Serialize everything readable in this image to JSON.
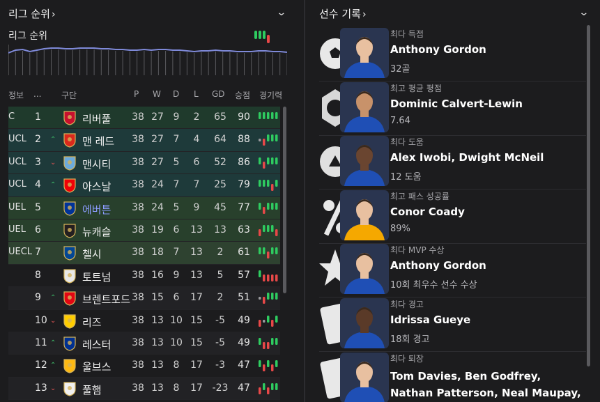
{
  "league_panel": {
    "header": "리그 순위",
    "subtitle": "리그 순위",
    "columns": {
      "info": "정보",
      "dots": "...",
      "club": "구단",
      "p": "P",
      "w": "W",
      "d": "D",
      "l": "L",
      "gd": "GD",
      "pts": "승점",
      "form": "경기력"
    },
    "rows": [
      {
        "q": "C",
        "pos": "1",
        "mv": "",
        "team": "리버풀",
        "p": "38",
        "w": "27",
        "d": "9",
        "l": "2",
        "gd": "65",
        "pts": "90",
        "crest": "#c8102e",
        "form": [
          "W",
          "W",
          "W",
          "W",
          "W"
        ],
        "bg": "#1f3a2c"
      },
      {
        "q": "UCL",
        "pos": "2",
        "mv": "up",
        "team": "맨 레드",
        "p": "38",
        "w": "27",
        "d": "7",
        "l": "4",
        "gd": "64",
        "pts": "88",
        "crest": "#da291c",
        "form": [
          "D",
          "L",
          "W",
          "W",
          "W"
        ],
        "bg": "#1e3a3a"
      },
      {
        "q": "UCL",
        "pos": "3",
        "mv": "down",
        "team": "맨시티",
        "p": "38",
        "w": "27",
        "d": "5",
        "l": "6",
        "gd": "52",
        "pts": "86",
        "crest": "#6cabdd",
        "form": [
          "W",
          "L",
          "W",
          "W",
          "W"
        ],
        "bg": "#1e3a3a"
      },
      {
        "q": "UCL",
        "pos": "4",
        "mv": "up",
        "team": "아스날",
        "p": "38",
        "w": "24",
        "d": "7",
        "l": "7",
        "gd": "25",
        "pts": "79",
        "crest": "#ef0107",
        "form": [
          "W",
          "W",
          "W",
          "L",
          "W"
        ],
        "bg": "#1e3a3a"
      },
      {
        "q": "UEL",
        "pos": "5",
        "mv": "",
        "team": "에버튼",
        "p": "38",
        "w": "24",
        "d": "5",
        "l": "9",
        "gd": "45",
        "pts": "77",
        "crest": "#003399",
        "form": [
          "W",
          "L",
          "W",
          "W",
          "W"
        ],
        "bg": "#28402c",
        "highlight": true
      },
      {
        "q": "UEL",
        "pos": "6",
        "mv": "",
        "team": "뉴캐슬",
        "p": "38",
        "w": "19",
        "d": "6",
        "l": "13",
        "gd": "13",
        "pts": "63",
        "crest": "#241f20",
        "form": [
          "L",
          "W",
          "W",
          "W",
          "L"
        ],
        "bg": "#28402c"
      },
      {
        "q": "UECL",
        "pos": "7",
        "mv": "",
        "team": "첼시",
        "p": "38",
        "w": "18",
        "d": "7",
        "l": "13",
        "gd": "2",
        "pts": "61",
        "crest": "#034694",
        "form": [
          "W",
          "W",
          "L",
          "W",
          "W"
        ],
        "bg": "#2e4230"
      },
      {
        "q": "",
        "pos": "8",
        "mv": "",
        "team": "토트넘",
        "p": "38",
        "w": "16",
        "d": "9",
        "l": "13",
        "gd": "5",
        "pts": "57",
        "crest": "#e8e8e8",
        "form": [
          "W",
          "L",
          "L",
          "L",
          "L"
        ],
        "bg": "#1c1c1e"
      },
      {
        "q": "",
        "pos": "9",
        "mv": "up",
        "team": "브렌트포드",
        "p": "38",
        "w": "15",
        "d": "6",
        "l": "17",
        "gd": "2",
        "pts": "51",
        "crest": "#e30613",
        "form": [
          "D",
          "L",
          "W",
          "W",
          "W"
        ],
        "bg": "#222225"
      },
      {
        "q": "",
        "pos": "10",
        "mv": "down",
        "team": "리즈",
        "p": "38",
        "w": "13",
        "d": "10",
        "l": "15",
        "gd": "-5",
        "pts": "49",
        "crest": "#ffcd00",
        "form": [
          "L",
          "D",
          "W",
          "L",
          "W"
        ],
        "bg": "#1c1c1e"
      },
      {
        "q": "",
        "pos": "11",
        "mv": "up",
        "team": "레스터",
        "p": "38",
        "w": "13",
        "d": "10",
        "l": "15",
        "gd": "-5",
        "pts": "49",
        "crest": "#003090",
        "form": [
          "W",
          "L",
          "L",
          "W",
          "W"
        ],
        "bg": "#222225"
      },
      {
        "q": "",
        "pos": "12",
        "mv": "up",
        "team": "울브스",
        "p": "38",
        "w": "13",
        "d": "8",
        "l": "17",
        "gd": "-3",
        "pts": "47",
        "crest": "#fdb913",
        "form": [
          "W",
          "L",
          "W",
          "L",
          "W"
        ],
        "bg": "#1c1c1e"
      },
      {
        "q": "",
        "pos": "13",
        "mv": "down",
        "team": "풀햄",
        "p": "38",
        "w": "13",
        "d": "8",
        "l": "17",
        "gd": "-23",
        "pts": "47",
        "crest": "#f0f0f0",
        "form": [
          "L",
          "W",
          "L",
          "W",
          "W"
        ],
        "bg": "#222225"
      }
    ],
    "mini_form": [
      "W",
      "W",
      "W",
      "L"
    ]
  },
  "records_panel": {
    "header": "선수 기록",
    "records": [
      {
        "label": "최다 득점",
        "name": "Anthony Gordon",
        "value": "32골",
        "icon": "ball-icon",
        "kit": "#1f4fb5",
        "skin": "#e8c0a0"
      },
      {
        "label": "최고 평균 평점",
        "name": "Dominic Calvert-Lewin",
        "value": "7.64",
        "icon": "badge-icon",
        "kit": "#1f4fb5",
        "skin": "#c8926a"
      },
      {
        "label": "최다 도움",
        "name": "Alex Iwobi, Dwight McNeil",
        "value": "12 도움",
        "icon": "assist-icon",
        "kit": "#1f4fb5",
        "skin": "#6a4530"
      },
      {
        "label": "최고 패스 성공률",
        "name": "Conor Coady",
        "value": "89%",
        "icon": "percent-icon",
        "kit": "#f5a800",
        "skin": "#e8c0a0"
      },
      {
        "label": "최다 MVP 수상",
        "name": "Anthony Gordon",
        "value": "10회 최우수 선수 수상",
        "icon": "star-icon",
        "kit": "#1f4fb5",
        "skin": "#e8c0a0"
      },
      {
        "label": "최다 경고",
        "name": "Idrissa Gueye",
        "value": "18회 경고",
        "icon": "card-icon",
        "kit": "#1f4fb5",
        "skin": "#5a3a28"
      },
      {
        "label": "최다 퇴장",
        "name": "Tom Davies, Ben Godfrey, Nathan Patterson, Neal Maupay,",
        "value": "",
        "icon": "red-card-icon",
        "kit": "#1f4fb5",
        "skin": "#e8c0a0"
      }
    ]
  }
}
